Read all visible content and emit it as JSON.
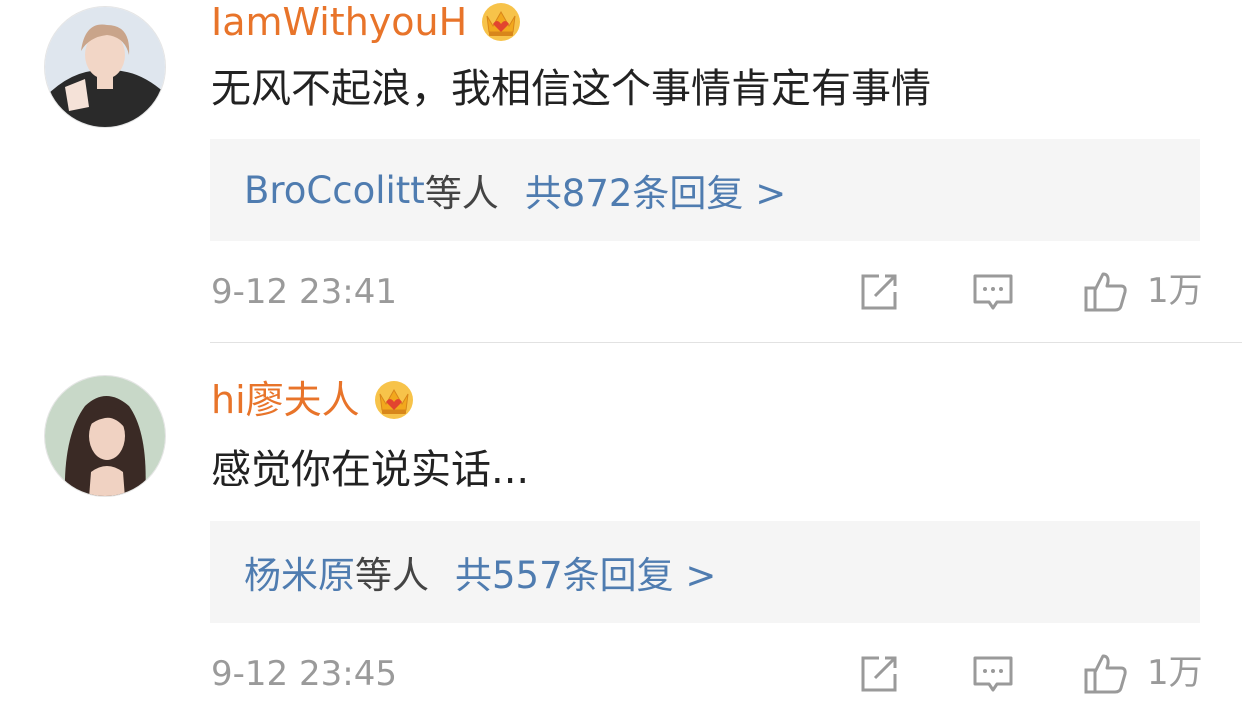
{
  "comments": [
    {
      "username": "IamWithyouH",
      "badge": "crown-icon",
      "text": "无风不起浪，我相信这个事情肯定有事情",
      "reply_users": "BroCcolitt",
      "reply_suffix": "等人",
      "reply_total": "共872条回复 >",
      "time": "9-12 23:41",
      "likes": "1万"
    },
    {
      "username": "hi廖夫人",
      "badge": "crown-icon",
      "text": "感觉你在说实话...",
      "reply_users": "杨米原",
      "reply_suffix": "等人",
      "reply_total": "共557条回复 >",
      "time": "9-12 23:45",
      "likes": "1万"
    }
  ],
  "colors": {
    "username": "#e8742a",
    "link": "#4f7cb0",
    "meta": "#9a9a9a",
    "reply_bg": "#f5f5f5"
  }
}
